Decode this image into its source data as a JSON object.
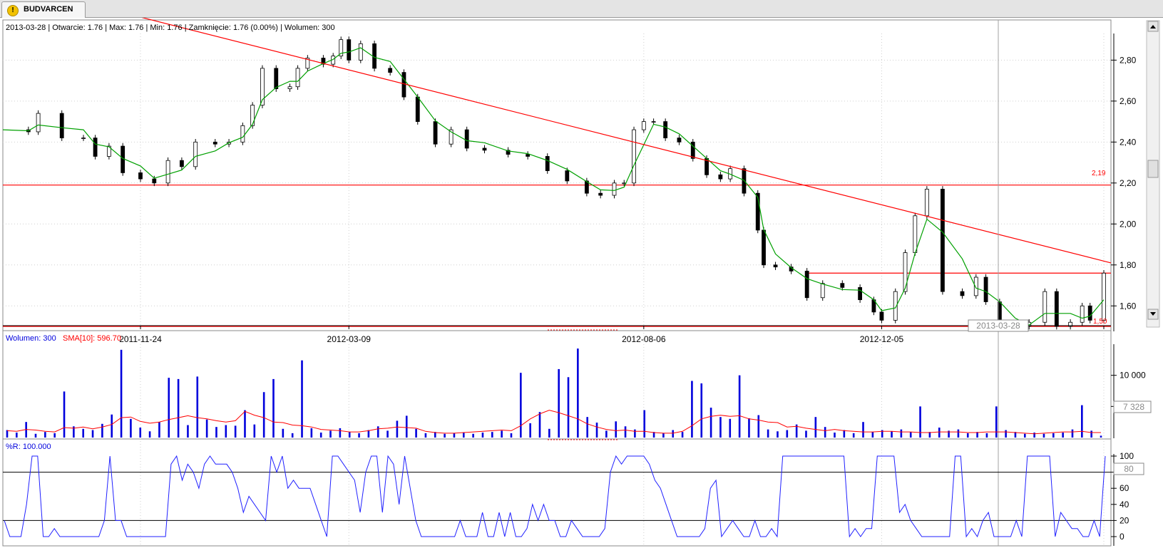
{
  "tab": {
    "title": "BUDVARCEN",
    "icon": "warning-icon"
  },
  "price_panel": {
    "info": "2013-03-28 | Otwarcie: 1.76 | Max: 1.76 | Min: 1.76 | Zamknięcie: 1.76 (0.00%)  | Wolumen: 300",
    "x_ticks": [
      "2011-11-24",
      "2012-03-09",
      "2012-08-06",
      "2012-12-05",
      "2013-03-28"
    ],
    "cursor_label": "2013-03-28",
    "y_ticks": [
      "1,60",
      "1,80",
      "2,00",
      "2,20",
      "2,40",
      "2,60",
      "2,80"
    ],
    "level_label_219": "2,19",
    "level_label_150": "1,50"
  },
  "volume_panel": {
    "label_volume": "Wolumen: 300",
    "label_sma": "SMA[10]: 596.70",
    "y_ticks": [
      "5 000",
      "10 000"
    ],
    "current_value_box": "7 328"
  },
  "wr_panel": {
    "label": "%R: 100.000",
    "y_ticks": [
      "0",
      "20",
      "40",
      "60",
      "80",
      "100"
    ],
    "current_value_box": "80"
  },
  "colors": {
    "candle_up": "#ffffff",
    "candle_down": "#000000",
    "sma_price": "#00a000",
    "trend": "#ff0000",
    "volume_bar": "#0000dd",
    "volume_sma": "#ff0000",
    "wr_line": "#2020ff"
  },
  "chart_data": [
    {
      "type": "candlestick",
      "x_range": [
        "2011-09-15",
        "2013-03-28"
      ],
      "ylim": [
        1.5,
        2.93
      ],
      "moving_average": "green",
      "close_path": [
        [
          "2011-09-15",
          2.46
        ],
        [
          "2011-09-28",
          2.45
        ],
        [
          "2011-10-03",
          2.54
        ],
        [
          "2011-10-15",
          2.42
        ],
        [
          "2011-10-26",
          2.42
        ],
        [
          "2011-11-01",
          2.33
        ],
        [
          "2011-11-08",
          2.38
        ],
        [
          "2011-11-15",
          2.25
        ],
        [
          "2011-11-24",
          2.22
        ],
        [
          "2011-12-01",
          2.2
        ],
        [
          "2011-12-08",
          2.31
        ],
        [
          "2011-12-15",
          2.28
        ],
        [
          "2011-12-22",
          2.4
        ],
        [
          "2012-01-01",
          2.39
        ],
        [
          "2012-01-08",
          2.4
        ],
        [
          "2012-01-15",
          2.48
        ],
        [
          "2012-01-20",
          2.58
        ],
        [
          "2012-01-25",
          2.76
        ],
        [
          "2012-02-01",
          2.66
        ],
        [
          "2012-02-08",
          2.67
        ],
        [
          "2012-02-12",
          2.76
        ],
        [
          "2012-02-17",
          2.81
        ],
        [
          "2012-02-25",
          2.78
        ],
        [
          "2012-03-01",
          2.82
        ],
        [
          "2012-03-05",
          2.9
        ],
        [
          "2012-03-09",
          2.8
        ],
        [
          "2012-03-15",
          2.88
        ],
        [
          "2012-03-22",
          2.76
        ],
        [
          "2012-03-30",
          2.74
        ],
        [
          "2012-04-06",
          2.62
        ],
        [
          "2012-04-13",
          2.5
        ],
        [
          "2012-04-22",
          2.39
        ],
        [
          "2012-04-30",
          2.46
        ],
        [
          "2012-05-08",
          2.37
        ],
        [
          "2012-05-17",
          2.36
        ],
        [
          "2012-05-29",
          2.34
        ],
        [
          "2012-06-08",
          2.33
        ],
        [
          "2012-06-18",
          2.26
        ],
        [
          "2012-06-28",
          2.21
        ],
        [
          "2012-07-08",
          2.15
        ],
        [
          "2012-07-15",
          2.14
        ],
        [
          "2012-07-22",
          2.2
        ],
        [
          "2012-07-27",
          2.2
        ],
        [
          "2012-08-01",
          2.46
        ],
        [
          "2012-08-06",
          2.5
        ],
        [
          "2012-08-11",
          2.5
        ],
        [
          "2012-08-17",
          2.42
        ],
        [
          "2012-08-24",
          2.4
        ],
        [
          "2012-08-31",
          2.32
        ],
        [
          "2012-09-07",
          2.24
        ],
        [
          "2012-09-14",
          2.22
        ],
        [
          "2012-09-19",
          2.27
        ],
        [
          "2012-09-26",
          2.15
        ],
        [
          "2012-10-03",
          1.97
        ],
        [
          "2012-10-06",
          1.8
        ],
        [
          "2012-10-12",
          1.79
        ],
        [
          "2012-10-20",
          1.77
        ],
        [
          "2012-10-28",
          1.64
        ],
        [
          "2012-11-05",
          1.71
        ],
        [
          "2012-11-15",
          1.69
        ],
        [
          "2012-11-24",
          1.63
        ],
        [
          "2012-12-01",
          1.57
        ],
        [
          "2012-12-05",
          1.53
        ],
        [
          "2012-12-12",
          1.67
        ],
        [
          "2012-12-17",
          1.86
        ],
        [
          "2012-12-22",
          2.04
        ],
        [
          "2012-12-28",
          2.17
        ],
        [
          "2013-01-05",
          1.67
        ],
        [
          "2013-01-15",
          1.65
        ],
        [
          "2013-01-22",
          1.74
        ],
        [
          "2013-01-27",
          1.62
        ],
        [
          "2013-02-03",
          1.5
        ],
        [
          "2013-02-11",
          1.5
        ],
        [
          "2013-02-18",
          1.52
        ],
        [
          "2013-02-26",
          1.67
        ],
        [
          "2013-03-04",
          1.5
        ],
        [
          "2013-03-11",
          1.52
        ],
        [
          "2013-03-17",
          1.6
        ],
        [
          "2013-03-21",
          1.53
        ],
        [
          "2013-03-28",
          1.76
        ]
      ],
      "trendline": [
        [
          "2011-09-15",
          3.18
        ],
        [
          "2013-03-28",
          1.81
        ]
      ],
      "horizontal_levels": [
        {
          "value": 2.19,
          "label": "2,19",
          "from": "2011-09-15"
        },
        {
          "value": 1.76,
          "from": "2012-10-27"
        },
        {
          "value": 1.5,
          "label": "1,50",
          "from": "2011-09-15"
        }
      ],
      "xticks": [
        "2011-11-24",
        "2012-03-09",
        "2012-08-06",
        "2012-12-05",
        "2013-03-28"
      ],
      "yticks": [
        1.6,
        1.8,
        2.0,
        2.2,
        2.4,
        2.6,
        2.8
      ]
    },
    {
      "type": "bar",
      "series": [
        {
          "name": "Wolumen",
          "values": [
            1200,
            800,
            2500,
            600,
            900,
            700,
            7400,
            1800,
            1400,
            1200,
            2200,
            3700,
            14100,
            3000,
            1600,
            1000,
            2500,
            9600,
            9400,
            2000,
            9800,
            2900,
            1700,
            2000,
            1900,
            4400,
            2100,
            7300,
            9400,
            1400,
            700,
            12400,
            1500,
            800,
            1100,
            1500,
            900,
            700,
            1200,
            1800,
            1100,
            2700,
            3500,
            1400,
            700,
            900,
            600,
            700,
            800,
            600,
            800,
            900,
            1100,
            700,
            10400,
            2300,
            4100,
            1400,
            11000,
            9700,
            14300,
            3300,
            2400,
            1100,
            2600,
            1800,
            1300,
            4400,
            900,
            700,
            1200,
            900,
            9100,
            8700,
            4800,
            3300,
            3000,
            10000,
            3100,
            3600,
            1300,
            1000,
            1200,
            2100,
            1100,
            3300,
            1700,
            800,
            1200,
            700,
            2500,
            900,
            1200,
            1000,
            1300,
            900,
            5000,
            900,
            1600,
            1100,
            1300,
            700,
            900,
            700,
            5000,
            1200,
            900,
            600,
            800,
            600,
            700,
            800,
            1300,
            5200,
            1100,
            300
          ]
        },
        {
          "name": "SMA[10]",
          "values": [
            1100,
            1000,
            1300,
            1200,
            1000,
            900,
            1600,
            1500,
            1700,
            1400,
            1700,
            2100,
            3200,
            3300,
            2600,
            2300,
            2500,
            2900,
            3200,
            3500,
            3200,
            3000,
            2700,
            2500,
            2700,
            4200,
            3600,
            3200,
            2500,
            2400,
            2000,
            1900,
            1700,
            1300,
            1200,
            1100,
            900,
            900,
            1100,
            1400,
            1500,
            1700,
            1600,
            1500,
            1000,
            800,
            700,
            700,
            800,
            900,
            1000,
            1100,
            1200,
            1100,
            1900,
            3000,
            3800,
            4400,
            4000,
            3500,
            3000,
            2200,
            1700,
            1300,
            1100,
            1200,
            1000,
            1000,
            800,
            700,
            700,
            1000,
            1900,
            3000,
            3400,
            3600,
            3400,
            3500,
            3000,
            2800,
            2500,
            2400,
            1700,
            1800,
            1500,
            1300,
            1100,
            1300,
            1100,
            1000,
            900,
            900,
            1000,
            1000,
            900,
            900,
            800,
            800,
            900,
            900,
            900,
            800,
            800,
            900,
            900,
            900,
            800,
            700,
            600,
            700,
            800,
            900,
            900,
            1000,
            800,
            800
          ]
        }
      ],
      "yticks": [
        5000,
        10000
      ],
      "ylim": [
        0,
        15000
      ]
    },
    {
      "type": "line",
      "series": [
        {
          "name": "%R",
          "values": [
            20,
            0,
            0,
            0,
            40,
            100,
            100,
            0,
            0,
            10,
            0,
            0,
            0,
            0,
            0,
            0,
            0,
            0,
            20,
            100,
            20,
            20,
            0,
            0,
            0,
            0,
            0,
            0,
            0,
            0,
            90,
            100,
            70,
            90,
            80,
            60,
            90,
            100,
            90,
            90,
            90,
            80,
            60,
            30,
            50,
            40,
            30,
            20,
            100,
            80,
            100,
            60,
            70,
            60,
            60,
            60,
            40,
            20,
            0,
            100,
            100,
            90,
            80,
            70,
            30,
            80,
            100,
            100,
            30,
            100,
            90,
            40,
            100,
            60,
            20,
            0,
            0,
            0,
            0,
            0,
            0,
            0,
            20,
            0,
            0,
            0,
            30,
            0,
            0,
            30,
            0,
            30,
            0,
            0,
            10,
            40,
            20,
            40,
            20,
            20,
            0,
            0,
            20,
            10,
            0,
            0,
            0,
            0,
            10,
            80,
            100,
            90,
            100,
            100,
            100,
            100,
            90,
            70,
            60,
            40,
            20,
            0,
            0,
            0,
            0,
            0,
            10,
            60,
            70,
            0,
            10,
            20,
            10,
            0,
            0,
            20,
            0,
            0,
            10,
            0,
            100,
            100,
            100,
            100,
            100,
            100,
            100,
            100,
            100,
            100,
            100,
            100,
            0,
            10,
            0,
            10,
            10,
            100,
            100,
            100,
            100,
            30,
            40,
            20,
            10,
            0,
            0,
            0,
            0,
            0,
            0,
            100,
            100,
            0,
            10,
            0,
            20,
            30,
            0,
            0,
            0,
            0,
            20,
            0,
            100,
            100,
            100,
            100,
            100,
            0,
            30,
            20,
            10,
            10,
            0,
            0,
            20,
            0,
            100
          ]
        }
      ],
      "yticks": [
        0,
        20,
        40,
        60,
        80,
        100
      ],
      "ylim": [
        0,
        100
      ],
      "reference_lines": [
        20,
        80
      ]
    }
  ]
}
